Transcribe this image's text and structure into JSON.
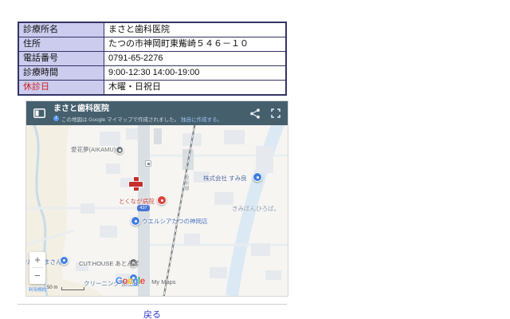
{
  "table": {
    "rows": [
      {
        "label": "診療所名",
        "value": "まさと歯科医院"
      },
      {
        "label": "住所",
        "value": "たつの市神岡町東觜崎５４６－１０"
      },
      {
        "label": "電話番号",
        "value": "0791-65-2276"
      },
      {
        "label": "診療時間",
        "value": "9:00-12:30 14:00-19:00"
      },
      {
        "label": "休診日",
        "value": "木曜・日祝日"
      }
    ]
  },
  "map": {
    "header": {
      "title": "まさと歯科医院",
      "attribution": "この地図は Google マイマップで作成されました。",
      "attribution_link": "独自に作成する。",
      "bg_color": "#455f6d"
    },
    "pois": {
      "aikamu": "愛花夢(AIKAMU)",
      "tokunaga_hospital": "とくなが病院",
      "sumiryo_company": "株式会社 すみ良",
      "kimibon_square": "きみぼんひろば。",
      "welcia": "ウエルシアたつの神岡店",
      "masan_prefix": "リフ",
      "masan": "まさん",
      "cut_house": "CUT.HOUSE あとんば",
      "cleaning_shimada": "クリーニング 島田店",
      "railway_line": "姫新線",
      "route_number": "437"
    },
    "watermark": {
      "letters": [
        "G",
        "o",
        "o",
        "g",
        "l",
        "e"
      ],
      "my_maps": "My Maps"
    },
    "controls": {
      "zoom_in": "+",
      "zoom_out": "−",
      "terms": "利用規約",
      "scale": "50 m"
    }
  },
  "footer": {
    "back_label": "戻る"
  }
}
